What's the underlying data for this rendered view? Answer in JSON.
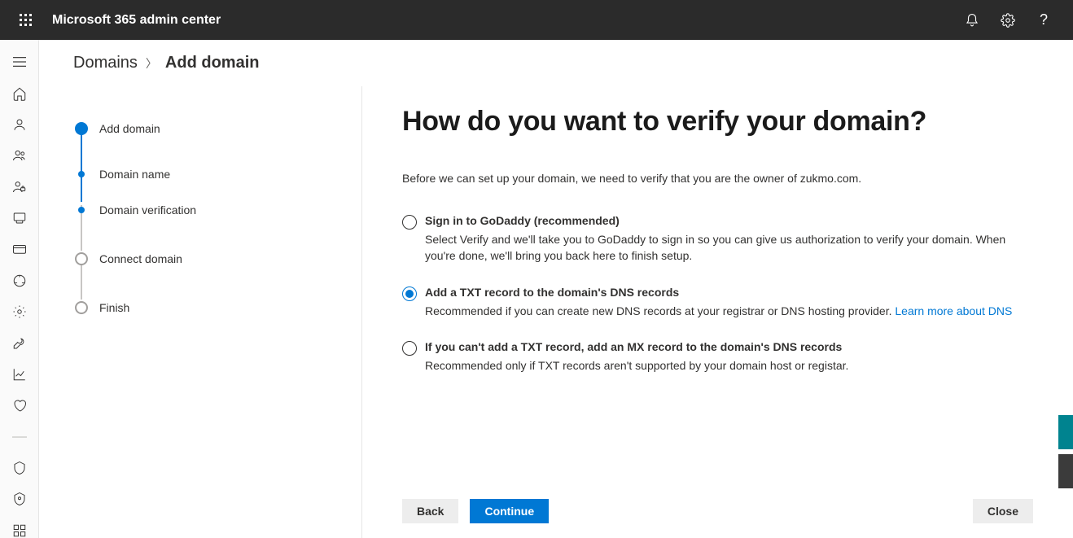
{
  "header": {
    "app_title": "Microsoft 365 admin center"
  },
  "breadcrumb": {
    "parent": "Domains",
    "current": "Add domain"
  },
  "stepper": [
    {
      "label": "Add domain",
      "type": "major",
      "state": "done"
    },
    {
      "label": "Domain name",
      "type": "minor",
      "state": "done"
    },
    {
      "label": "Domain verification",
      "type": "minor",
      "state": "done"
    },
    {
      "label": "Connect domain",
      "type": "major",
      "state": "todo"
    },
    {
      "label": "Finish",
      "type": "major",
      "state": "todo"
    }
  ],
  "page": {
    "heading": "How do you want to verify your domain?",
    "subcopy": "Before we can set up your domain, we need to verify that you are the owner of zukmo.com."
  },
  "options": [
    {
      "title": "Sign in to GoDaddy (recommended)",
      "desc": "Select Verify and we'll take you to GoDaddy to sign in so you can give us authorization to verify your domain. When you're done, we'll bring you back here to finish setup.",
      "selected": false
    },
    {
      "title": "Add a TXT record to the domain's DNS records",
      "desc": "Recommended if you can create new DNS records at your registrar or DNS hosting provider. ",
      "link": "Learn more about DNS",
      "selected": true
    },
    {
      "title": "If you can't add a TXT record, add an MX record to the domain's DNS records",
      "desc": "Recommended only if TXT records aren't supported by your domain host or registar.",
      "selected": false
    }
  ],
  "footer": {
    "back": "Back",
    "continue": "Continue",
    "close": "Close"
  }
}
